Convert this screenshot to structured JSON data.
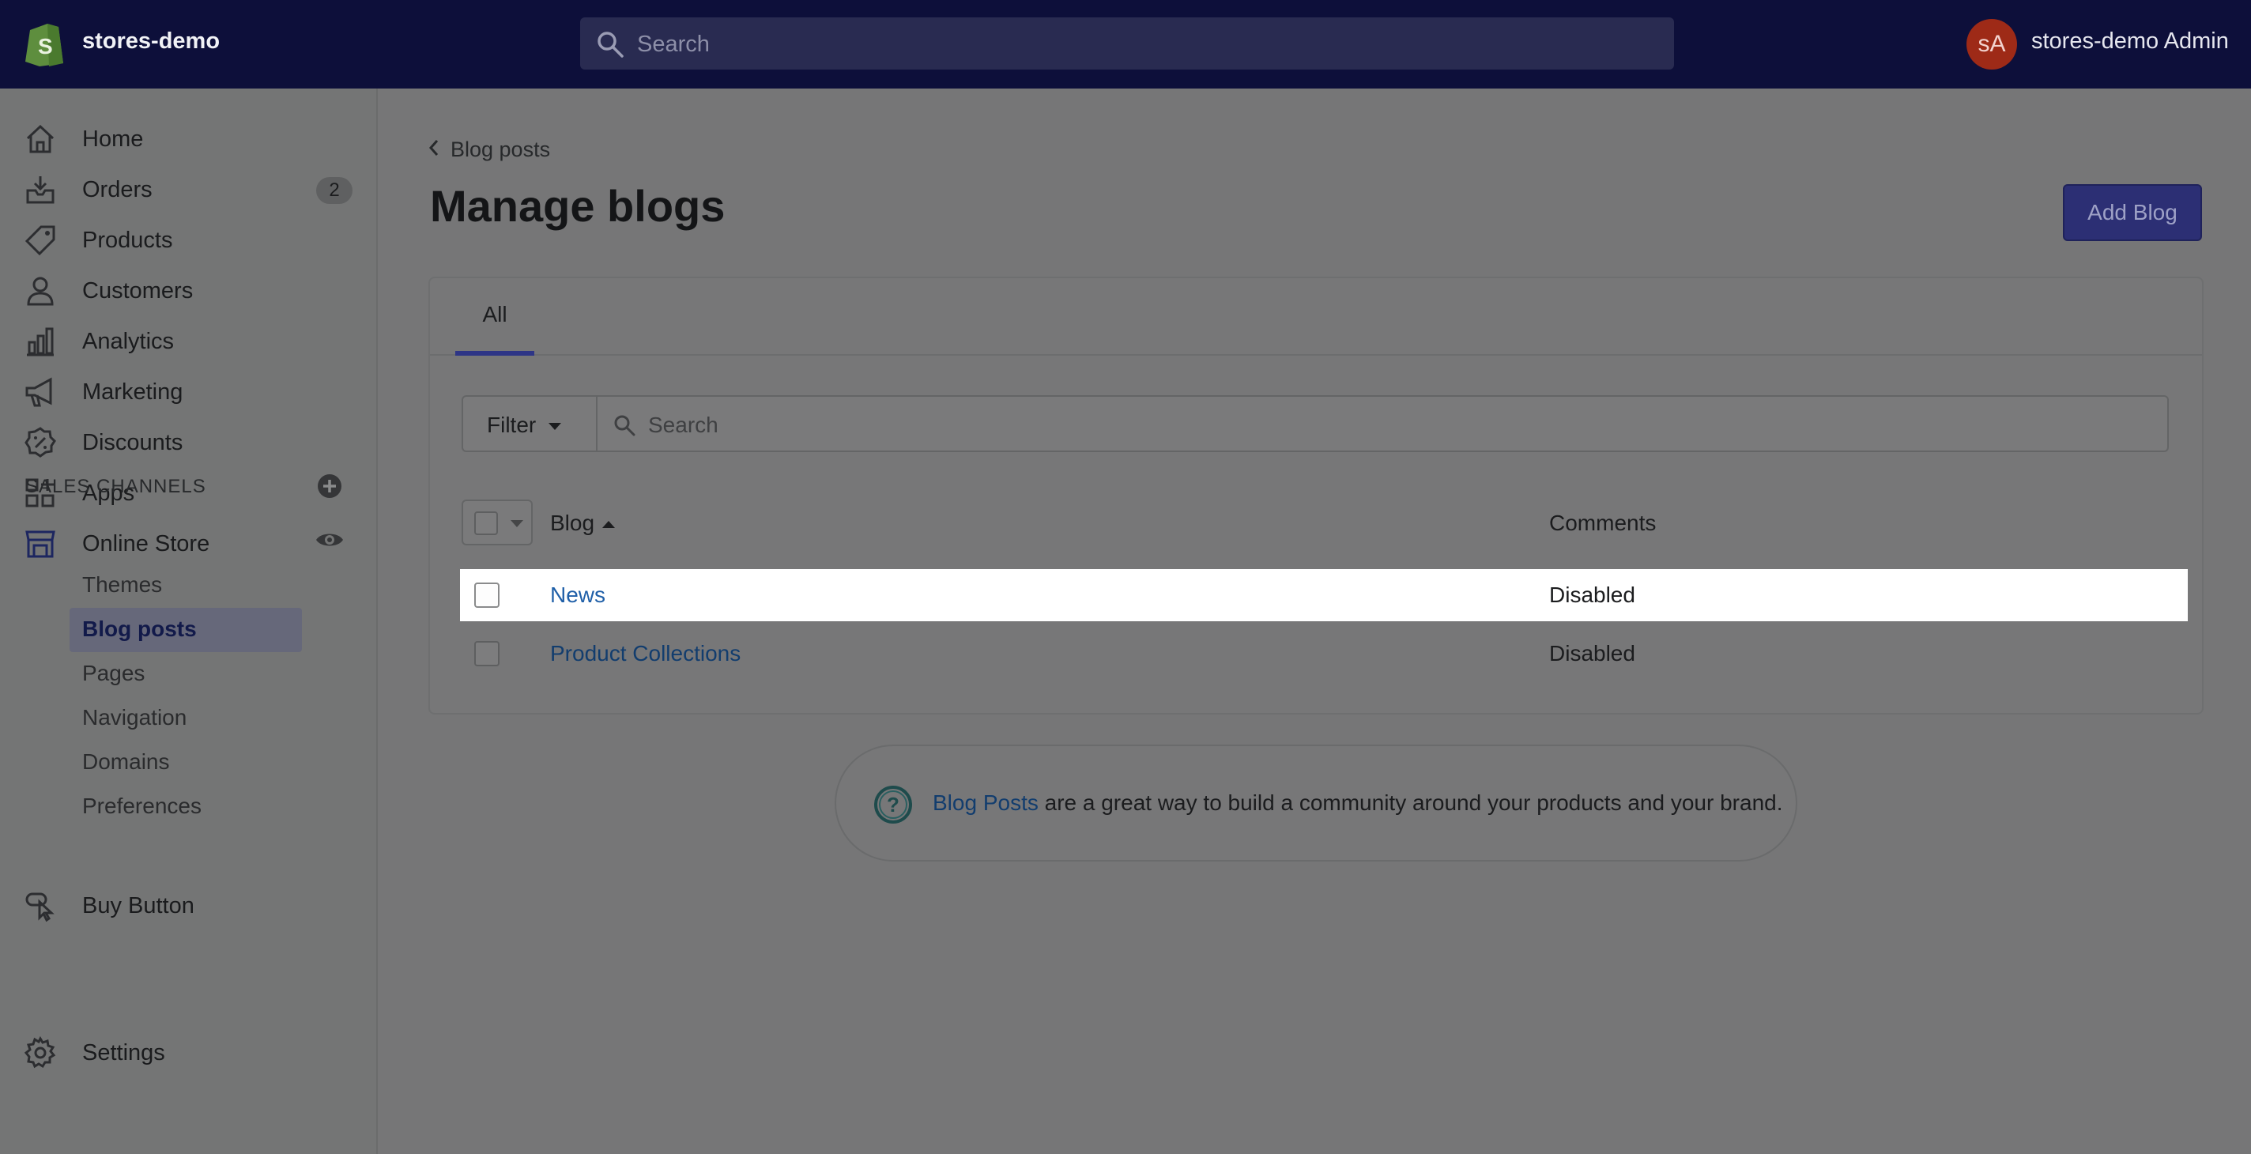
{
  "topbar": {
    "store_name": "stores-demo",
    "search_placeholder": "Search",
    "avatar_initials": "sA",
    "admin_name": "stores-demo Admin"
  },
  "sidebar": {
    "items": [
      {
        "label": "Home",
        "icon": "home-icon"
      },
      {
        "label": "Orders",
        "icon": "orders-icon",
        "badge": "2"
      },
      {
        "label": "Products",
        "icon": "tag-icon"
      },
      {
        "label": "Customers",
        "icon": "person-icon"
      },
      {
        "label": "Analytics",
        "icon": "bar-chart-icon"
      },
      {
        "label": "Marketing",
        "icon": "megaphone-icon"
      },
      {
        "label": "Discounts",
        "icon": "discount-icon"
      },
      {
        "label": "Apps",
        "icon": "apps-icon"
      }
    ],
    "sales_channels_title": "SALES CHANNELS",
    "online_store": "Online Store",
    "sub_items": [
      "Themes",
      "Blog posts",
      "Pages",
      "Navigation",
      "Domains",
      "Preferences"
    ],
    "active_sub_item": "Blog posts",
    "buy_button": "Buy Button",
    "settings": "Settings"
  },
  "main": {
    "breadcrumb": "Blog posts",
    "title": "Manage blogs",
    "add_button": "Add Blog",
    "tabs": [
      "All"
    ],
    "filter_label": "Filter",
    "search_placeholder": "Search",
    "columns": {
      "blog": "Blog",
      "comments": "Comments"
    },
    "rows": [
      {
        "name": "News",
        "comments": "Disabled"
      },
      {
        "name": "Product Collections",
        "comments": "Disabled"
      }
    ],
    "help": {
      "link": "Blog Posts",
      "text": " are a great way to build a community around your products and your brand."
    }
  },
  "colors": {
    "topbar": "#0d0f3a",
    "accent": "#2c2f74",
    "link": "#1f5fa8",
    "avatar": "#9e2a17"
  }
}
